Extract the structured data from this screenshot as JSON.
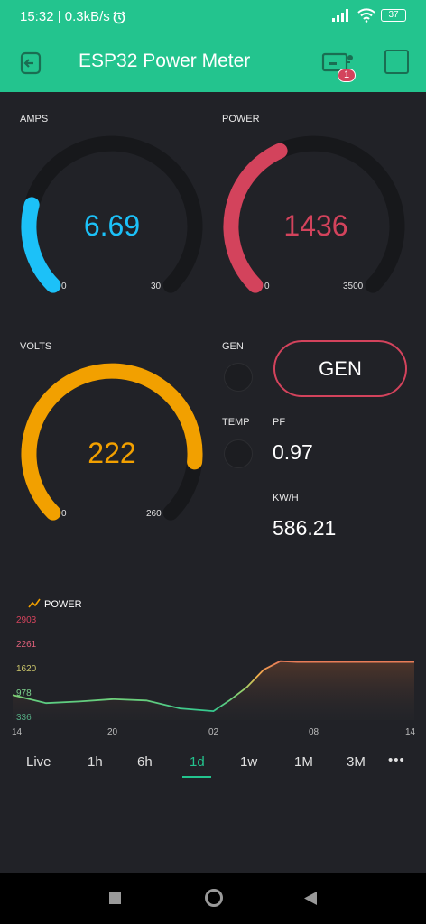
{
  "status": {
    "time": "15:32",
    "speed": "0.3kB/s",
    "battery": "37"
  },
  "appbar": {
    "title": "ESP32 Power Meter",
    "badge": "1"
  },
  "gauges": {
    "amps": {
      "label": "AMPS",
      "value": "6.69",
      "min": "0",
      "max": "30",
      "fraction": 0.223,
      "color": "#1cc1f8"
    },
    "power": {
      "label": "POWER",
      "value": "1436",
      "min": "0",
      "max": "3500",
      "fraction": 0.41,
      "color": "#d3435c"
    },
    "volts": {
      "label": "VOLTS",
      "value": "222",
      "min": "0",
      "max": "260",
      "fraction": 0.854,
      "color": "#f2a000"
    }
  },
  "leds": {
    "gen_label": "GEN",
    "temp_label": "TEMP"
  },
  "gen_button": {
    "label": "GEN"
  },
  "pf": {
    "label": "PF",
    "value": "0.97"
  },
  "kwh": {
    "label": "KW/H",
    "value": "586.21"
  },
  "chart_data": {
    "type": "area",
    "title": "POWER",
    "y_ticks": [
      "2903",
      "2261",
      "1620",
      "978",
      "336"
    ],
    "x_ticks": [
      "14",
      "20",
      "02",
      "08",
      "14"
    ],
    "ylim": [
      336,
      2903
    ],
    "x": [
      0,
      2,
      4,
      6,
      8,
      10,
      12,
      13,
      14,
      15,
      16,
      17,
      18,
      20,
      24
    ],
    "values": [
      1000,
      700,
      760,
      850,
      800,
      500,
      400,
      820,
      1300,
      1950,
      2270,
      2240,
      2240,
      2240,
      2240
    ]
  },
  "ranges": [
    "Live",
    "1h",
    "6h",
    "1d",
    "1w",
    "1M",
    "3M"
  ],
  "active_range": "1d",
  "more": "•••"
}
